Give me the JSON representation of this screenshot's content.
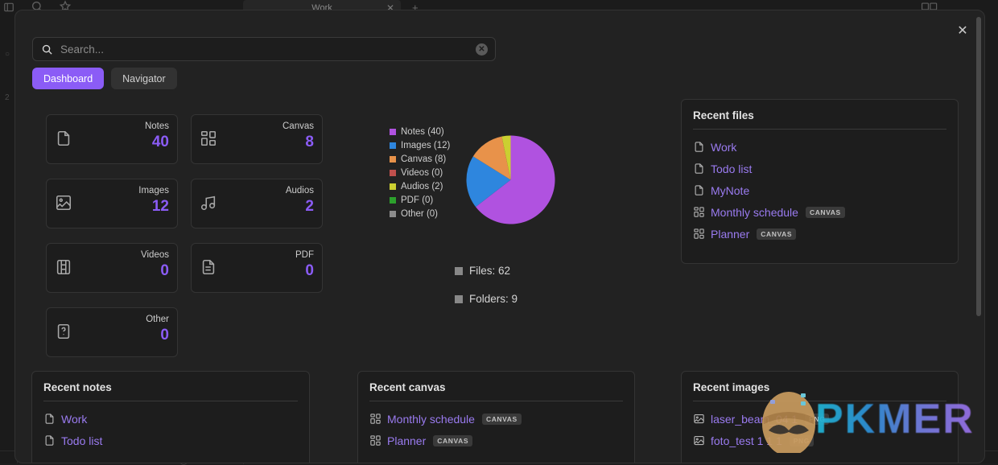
{
  "background": {
    "tab_title": "Work",
    "tab_close_icon": "close-icon",
    "new_tab_icon": "plus-icon",
    "search_icon": "search-icon",
    "bookmark_icon": "bookmark-icon",
    "sidebar_icon": "sidebar-toggle-icon"
  },
  "modal": {
    "close_icon": "close-icon",
    "search": {
      "value": "",
      "placeholder": "Search...",
      "icon": "search-icon",
      "clear_icon": "clear-icon"
    },
    "tabs": [
      {
        "label": "Dashboard",
        "active": true
      },
      {
        "label": "Navigator",
        "active": false
      }
    ],
    "stats": [
      {
        "label": "Notes",
        "value": "40",
        "icon": "file-icon"
      },
      {
        "label": "Canvas",
        "value": "8",
        "icon": "canvas-grid-icon"
      },
      {
        "label": "Images",
        "value": "12",
        "icon": "image-icon"
      },
      {
        "label": "Audios",
        "value": "2",
        "icon": "music-note-icon"
      },
      {
        "label": "Videos",
        "value": "0",
        "icon": "film-icon"
      },
      {
        "label": "PDF",
        "value": "0",
        "icon": "document-lines-icon"
      },
      {
        "label": "Other",
        "value": "0",
        "icon": "file-question-icon"
      }
    ],
    "counts": [
      {
        "label": "Files: 62"
      },
      {
        "label": "Folders: 9"
      }
    ],
    "panels": {
      "recent_files": {
        "title": "Recent files",
        "items": [
          {
            "label": "Work",
            "icon": "file-icon",
            "badge": ""
          },
          {
            "label": "Todo list",
            "icon": "file-icon",
            "badge": ""
          },
          {
            "label": "MyNote",
            "icon": "file-icon",
            "badge": ""
          },
          {
            "label": "Monthly schedule",
            "icon": "canvas-grid-icon",
            "badge": "CANVAS"
          },
          {
            "label": "Planner",
            "icon": "canvas-grid-icon",
            "badge": "CANVAS"
          }
        ]
      },
      "recent_notes": {
        "title": "Recent notes",
        "items": [
          {
            "label": "Work",
            "icon": "file-icon",
            "badge": ""
          },
          {
            "label": "Todo list",
            "icon": "file-icon",
            "badge": ""
          }
        ]
      },
      "recent_canvas": {
        "title": "Recent canvas",
        "items": [
          {
            "label": "Monthly schedule",
            "icon": "canvas-grid-icon",
            "badge": "CANVAS"
          },
          {
            "label": "Planner",
            "icon": "canvas-grid-icon",
            "badge": "CANVAS"
          }
        ]
      },
      "recent_images": {
        "title": "Recent images",
        "items": [
          {
            "label": "laser_beam_04 1",
            "icon": "image-icon",
            "badge": "PNG"
          },
          {
            "label": "foto_test 1 1 1",
            "icon": "image-icon",
            "badge": "PNG"
          }
        ]
      }
    }
  },
  "watermark": {
    "text": "PKMER",
    "logo_icon": "egg-logo-icon"
  },
  "theme": {
    "accent": "#8b5cf6",
    "link": "#9a7bf0",
    "modal_bg": "#222222",
    "card_bg": "#1d1d1d"
  },
  "chart_data": {
    "type": "pie",
    "title": "",
    "legend_position": "left",
    "total": 62,
    "categories": [
      "Notes",
      "Images",
      "Canvas",
      "Videos",
      "Audios",
      "PDF",
      "Other"
    ],
    "values": [
      40,
      12,
      8,
      0,
      2,
      0,
      0
    ],
    "colors": [
      "#b052e0",
      "#2e86de",
      "#e8924a",
      "#c0504d",
      "#cbcf31",
      "#2ca02c",
      "#8c8c8c"
    ],
    "legend_labels": [
      "Notes (40)",
      "Images (12)",
      "Canvas (8)",
      "Videos (0)",
      "Audios (2)",
      "PDF (0)",
      "Other (0)"
    ]
  }
}
